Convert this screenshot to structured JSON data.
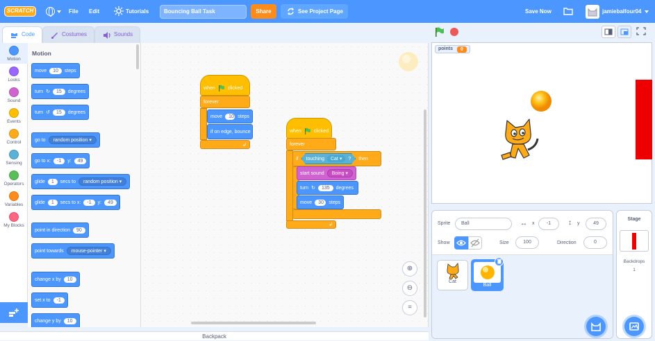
{
  "menubar": {
    "logo": "SCRATCH",
    "file": "File",
    "edit": "Edit",
    "tutorials": "Tutorials",
    "project_title": "Bouncing Ball Task",
    "share": "Share",
    "see_project": "See Project Page",
    "save_now": "Save Now",
    "username": "jamiebalfour04"
  },
  "tabs": {
    "code": "Code",
    "costumes": "Costumes",
    "sounds": "Sounds"
  },
  "categories": [
    "Motion",
    "Looks",
    "Sound",
    "Events",
    "Control",
    "Sensing",
    "Operators",
    "Variables",
    "My Blocks"
  ],
  "category_colors": [
    "#4c97ff",
    "#9966ff",
    "#cf63cf",
    "#ffbf00",
    "#ffab19",
    "#5cb1d6",
    "#59c059",
    "#ff8c1a",
    "#ff6680"
  ],
  "palette": {
    "title": "Motion",
    "move": {
      "a": "move",
      "n": "10",
      "b": "steps"
    },
    "turn_right": {
      "a": "turn",
      "n": "15",
      "b": "degrees"
    },
    "turn_left": {
      "a": "turn",
      "n": "15",
      "b": "degrees"
    },
    "goto": {
      "a": "go to",
      "d": "random position"
    },
    "gotoxy": {
      "a": "go to x:",
      "x": "-1",
      "b": "y:",
      "y": "49"
    },
    "glide1": {
      "a": "glide",
      "n": "1",
      "b": "secs to",
      "d": "random position"
    },
    "glide2": {
      "a": "glide",
      "n": "1",
      "b": "secs to x:",
      "x": "-1",
      "c": "y:",
      "y": "49"
    },
    "point_dir": {
      "a": "point in direction",
      "n": "90"
    },
    "point_towards": {
      "a": "point towards",
      "d": "mouse-pointer"
    },
    "change_x": {
      "a": "change x by",
      "n": "10"
    },
    "set_x": {
      "a": "set x to",
      "n": "-1"
    },
    "change_y": {
      "a": "change y by",
      "n": "10"
    }
  },
  "script1": {
    "hat": {
      "a": "when",
      "b": "clicked"
    },
    "forever": "forever",
    "move": {
      "a": "move",
      "n": "10",
      "b": "steps"
    },
    "bounce": "if on edge, bounce"
  },
  "script2": {
    "hat": {
      "a": "when",
      "b": "clicked"
    },
    "forever": "forever",
    "if": {
      "a": "if",
      "touching": "touching",
      "target": "Cat",
      "q": "?",
      "then": "then"
    },
    "sound": {
      "a": "start sound",
      "d": "Boing"
    },
    "turn": {
      "a": "turn",
      "n": "135",
      "b": "degrees"
    },
    "move": {
      "a": "move",
      "n": "30",
      "b": "steps"
    }
  },
  "backpack": "Backpack",
  "stage": {
    "monitor_label": "points",
    "monitor_value": "0"
  },
  "sprite_info": {
    "sprite_label": "Sprite",
    "sprite_name": "Ball",
    "x_label": "x",
    "x": "-1",
    "y_label": "y",
    "y": "49",
    "show_label": "Show",
    "size_label": "Size",
    "size": "100",
    "direction_label": "Direction",
    "direction": "0"
  },
  "sprites": [
    {
      "name": "Cat"
    },
    {
      "name": "Ball"
    }
  ],
  "stage_selector": {
    "title": "Stage",
    "backdrops_label": "Backdrops",
    "backdrops_count": "1"
  }
}
